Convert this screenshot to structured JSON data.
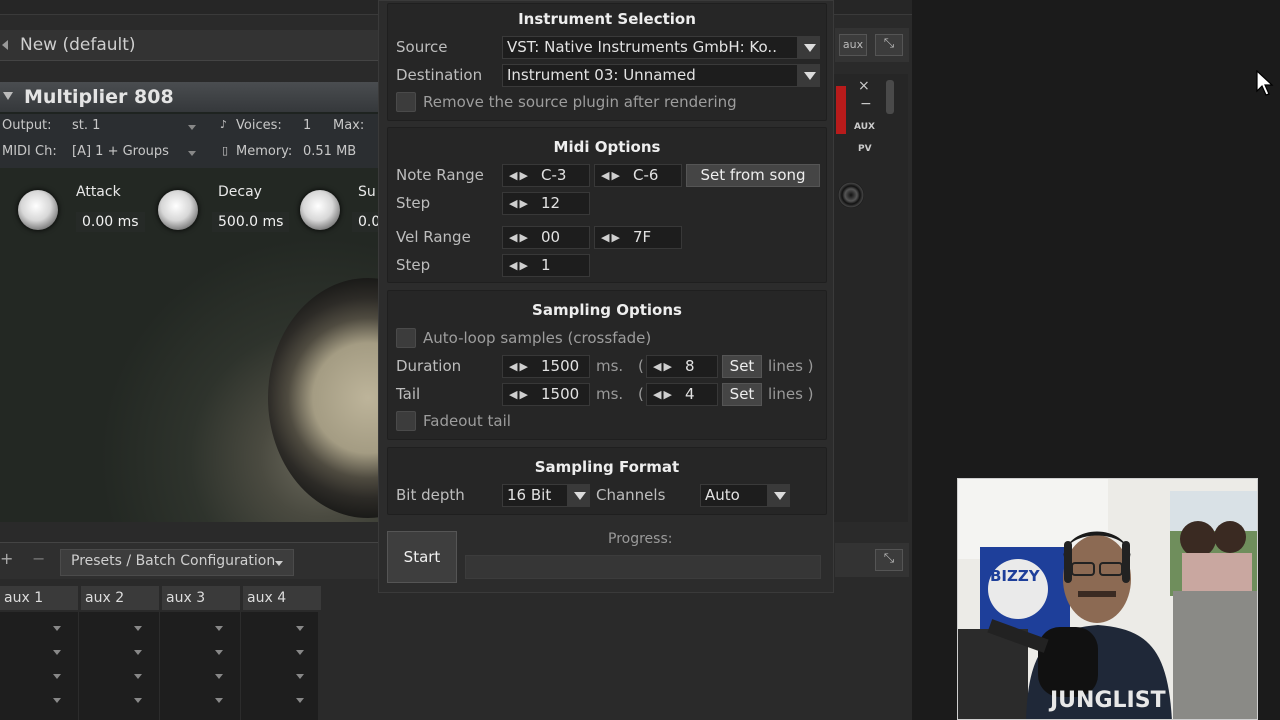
{
  "host": {
    "preset_name": "New (default)",
    "aux_button": "aux"
  },
  "kontakt": {
    "instrument_name": "Multiplier 808",
    "output_label": "Output:",
    "output_value": "st. 1",
    "voices_label": "Voices:",
    "voices_value": "1",
    "max_label": "Max:",
    "midi_label": "MIDI Ch:",
    "midi_value": "[A]  1 + Groups",
    "memory_label": "Memory:",
    "memory_value": "0.51 MB",
    "knobs": [
      {
        "label": "Attack",
        "value": "0.00  ms"
      },
      {
        "label": "Decay",
        "value": "500.0  ms"
      },
      {
        "label": "Su",
        "value": "0.0"
      }
    ],
    "side_buttons": [
      "AUX",
      "PV"
    ]
  },
  "bottom": {
    "presets_label": "Presets / Batch Configuration",
    "aux_columns": [
      "aux 1",
      "aux 2",
      "aux 3",
      "aux 4"
    ]
  },
  "dialog": {
    "instrument_selection": {
      "title": "Instrument Selection",
      "source_label": "Source",
      "source_value": "VST: Native Instruments GmbH: Ko..",
      "destination_label": "Destination",
      "destination_value": "Instrument 03: Unnamed",
      "remove_label": "Remove the source plugin after rendering",
      "remove_checked": false
    },
    "midi_options": {
      "title": "Midi Options",
      "note_range_label": "Note Range",
      "note_from": "C-3",
      "note_to": "C-6",
      "set_from_song": "Set from song",
      "step_label": "Step",
      "step_value": "12",
      "vel_range_label": "Vel Range",
      "vel_from": "00",
      "vel_to": "7F",
      "vel_step_label": "Step",
      "vel_step_value": "1"
    },
    "sampling_options": {
      "title": "Sampling Options",
      "autoloop_label": "Auto-loop samples (crossfade)",
      "autoloop_checked": false,
      "duration_label": "Duration",
      "duration_value": "1500",
      "duration_lines": "8",
      "tail_label": "Tail",
      "tail_value": "1500",
      "tail_lines": "4",
      "ms": "ms.",
      "paren_open": "(",
      "set": "Set",
      "lines": "lines )",
      "fadeout_label": "Fadeout tail",
      "fadeout_checked": false
    },
    "sampling_format": {
      "title": "Sampling Format",
      "bit_depth_label": "Bit depth",
      "bit_depth_value": "16 Bit",
      "channels_label": "Channels",
      "channels_value": "Auto"
    },
    "start_label": "Start",
    "progress_label": "Progress:",
    "progress": 0
  },
  "webcam": {
    "shirt_text": "JUNGLIST",
    "sign_text": "BIZZY"
  }
}
